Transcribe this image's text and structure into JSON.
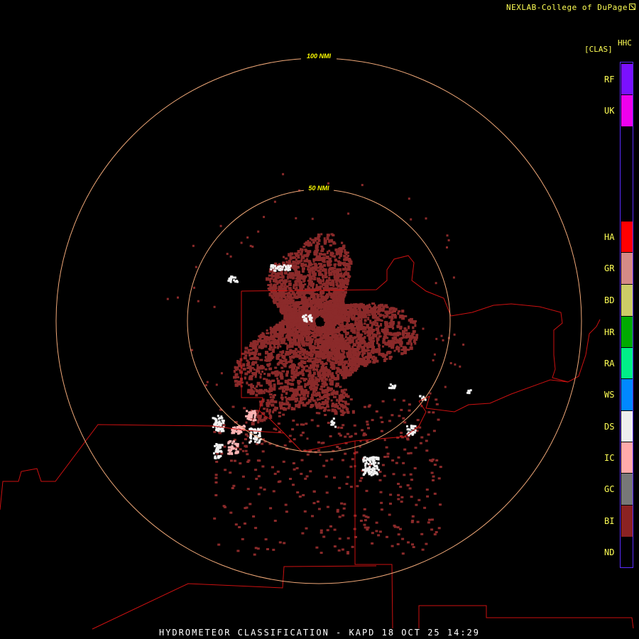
{
  "credit": {
    "text": "NEXLAB-College of DuPage"
  },
  "legend": {
    "code": "HHC",
    "unit": "[CLAS]",
    "classes": [
      {
        "label": "RF",
        "color": "#7a10ff"
      },
      {
        "label": "UK",
        "color": "#ee00ee"
      },
      {
        "label": "HA",
        "color": "#ff0000"
      },
      {
        "label": "GR",
        "color": "#d58a86"
      },
      {
        "label": "BD",
        "color": "#cccc66"
      },
      {
        "label": "HR",
        "color": "#00aa00"
      },
      {
        "label": "RA",
        "color": "#00ee88"
      },
      {
        "label": "WS",
        "color": "#0088ff"
      },
      {
        "label": "DS",
        "color": "#eeeeee"
      },
      {
        "label": "IC",
        "color": "#ffaaaa"
      },
      {
        "label": "GC",
        "color": "#777777"
      },
      {
        "label": "BI",
        "color": "#8b2222"
      },
      {
        "label": "ND",
        "color": "#000000"
      }
    ]
  },
  "range_rings": [
    {
      "label": "100 NMI",
      "range_nmi": 100
    },
    {
      "label": "50 NMI",
      "range_nmi": 50
    }
  ],
  "colors": {
    "ring": "#f0a878",
    "ring_label": "#ffff00",
    "borders": "#cc1111",
    "echo_bi": "#8b2a2a",
    "echo_ds": "#f2f2f2",
    "echo_ic": "#ffb6b6"
  },
  "footer": {
    "text": "HYDROMETEOR CLASSIFICATION - KAPD 18 OCT 25 14:29"
  }
}
